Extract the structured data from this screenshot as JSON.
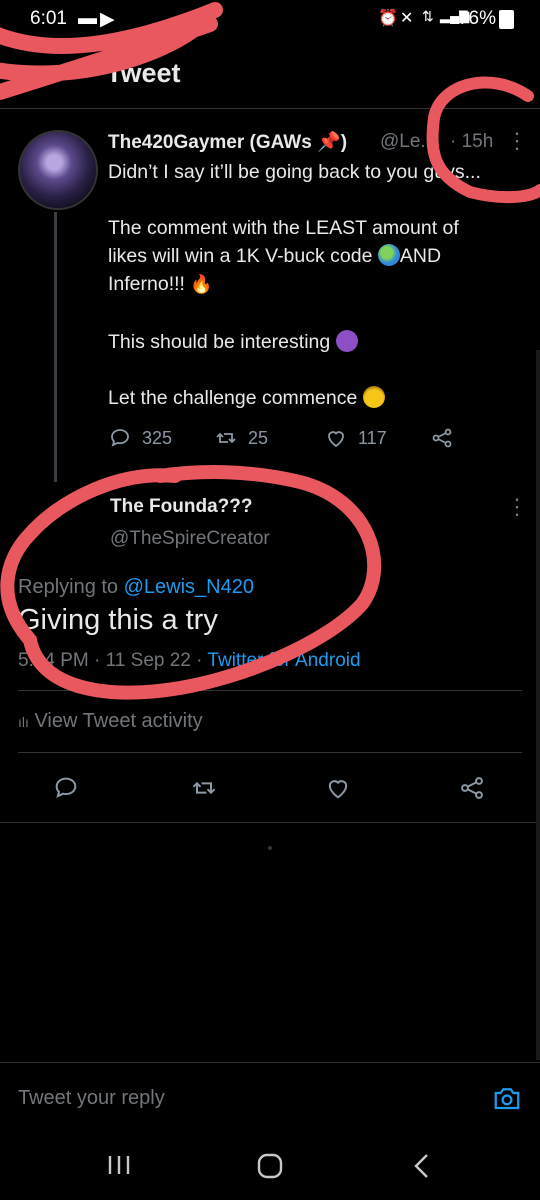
{
  "status_bar": {
    "time": "6:01",
    "battery": "76%"
  },
  "header": {
    "title": "Tweet"
  },
  "parent_tweet": {
    "author_name": "The420Gaymer (GAWs 📌)",
    "handle": "@Le...",
    "time": "· 15h",
    "lines": [
      "Didn’t I say it’ll be going back to you guys...",
      "The comment with the LEAST amount of",
      "likes will win a 1K V-buck code",
      "AND",
      "Inferno!!!",
      "This should be interesting",
      "Let the challenge commence"
    ],
    "replies": "325",
    "retweets": "25",
    "likes": "117"
  },
  "reply_tweet": {
    "author_name": "The Founda???",
    "handle": "@TheSpireCreator",
    "replying_prefix": "Replying to",
    "replying_to": "@Lewis_N420",
    "text": "Giving this a try",
    "time": "5:44 PM · 11 Sep 22 ·",
    "source": "Twitter for Android"
  },
  "activity": {
    "label": "View Tweet activity"
  },
  "compose": {
    "placeholder": "Tweet your reply"
  },
  "colors": {
    "accent": "#1d9bf0",
    "scribble": "#e8585e",
    "background": "#000000"
  }
}
